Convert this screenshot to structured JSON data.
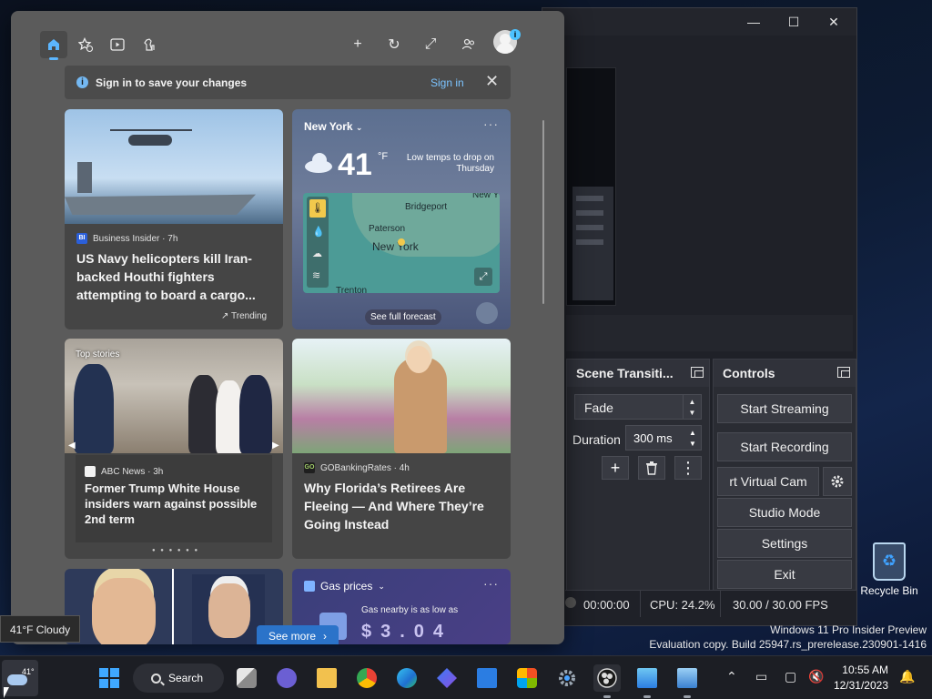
{
  "obs": {
    "window_controls": {
      "minimize": "—",
      "maximize": "☐",
      "close": "✕"
    },
    "scene_transitions": {
      "title": "Scene Transiti...",
      "transition_value": "Fade",
      "duration_label": "Duration",
      "duration_value": "300 ms"
    },
    "controls": {
      "title": "Controls",
      "buttons": {
        "start_streaming": "Start Streaming",
        "start_recording": "Start Recording",
        "virtual_cam": "rt Virtual Cam",
        "studio_mode": "Studio Mode",
        "settings": "Settings",
        "exit": "Exit"
      }
    },
    "status": {
      "time": "00:00:00",
      "cpu": "CPU: 24.2%",
      "fps": "30.00 / 30.00 FPS"
    }
  },
  "desktop": {
    "recycle_bin": "Recycle Bin",
    "watermark": {
      "line1": "Windows 11 Pro Insider Preview",
      "line2": "Evaluation copy. Build 25947.rs_prerelease.230901-1416"
    }
  },
  "widgets": {
    "avatar_badge": "i",
    "signin": {
      "message": "Sign in to save your changes",
      "link": "Sign in"
    },
    "cards": {
      "navy": {
        "source_logo": "BI",
        "source": "Business Insider · 7h",
        "headline": "US Navy helicopters kill Iran-backed Houthi fighters attempting to board a cargo...",
        "tag": "Trending"
      },
      "weather": {
        "location": "New York",
        "temp": "41",
        "unit": "°F",
        "note": "Low temps to drop on Thursday",
        "map_labels": {
          "bridgeport": "Bridgeport",
          "paterson": "Paterson",
          "new_york": "New York",
          "trenton": "Trenton",
          "new_edge": "New Y"
        },
        "forecast": "See full forecast"
      },
      "trump": {
        "badge": "Top stories",
        "source": "ABC News · 3h",
        "headline": "Former Trump White House insiders warn against possible 2nd term"
      },
      "florida": {
        "source_logo": "GO",
        "source": "GOBankingRates · 4h",
        "headline": "Why Florida’s Retirees Are Fleeing — And Where They’re Going Instead"
      },
      "gas": {
        "title": "Gas prices",
        "subtitle": "Gas nearby is as low as",
        "price": "$3.04"
      }
    },
    "see_more": "See more"
  },
  "tooltip": "41°F Cloudy",
  "taskbar": {
    "weather_temp": "41°",
    "search_label": "Search",
    "clock_time": "10:55 AM",
    "clock_date": "12/31/2023"
  },
  "colors": {
    "accent": "#4cc2ff",
    "link": "#7cc4ff",
    "see_more": "#2b73c9"
  }
}
